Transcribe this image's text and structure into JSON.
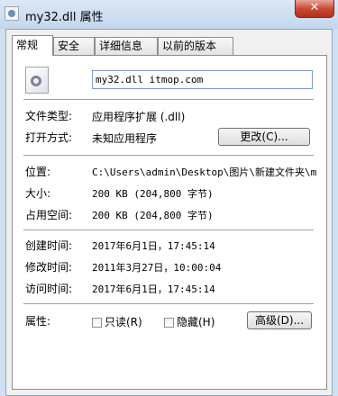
{
  "window": {
    "title": "my32.dll 属性",
    "close_glyph": "✕"
  },
  "tabs": [
    {
      "label": "常规",
      "active": true
    },
    {
      "label": "安全",
      "active": false
    },
    {
      "label": "详细信息",
      "active": false
    },
    {
      "label": "以前的版本",
      "active": false
    }
  ],
  "general": {
    "file_name": "my32.dll itmop.com",
    "file_type_label": "文件类型:",
    "file_type_value": "应用程序扩展 (.dll)",
    "open_with_label": "打开方式:",
    "open_with_value": "未知应用程序",
    "change_button": "更改(C)...",
    "location_label": "位置:",
    "location_value": "C:\\Users\\admin\\Desktop\\图片\\新建文件夹\\my",
    "size_label": "大小:",
    "size_value": "200 KB (204,800 字节)",
    "disk_size_label": "占用空间:",
    "disk_size_value": "200 KB (204,800 字节)",
    "created_label": "创建时间:",
    "created_value": "2017年6月1日，17:45:14",
    "modified_label": "修改时间:",
    "modified_value": "2011年3月27日，10:00:04",
    "accessed_label": "访问时间:",
    "accessed_value": "2017年6月1日，17:45:14",
    "attributes_label": "属性:",
    "readonly_label": "只读(R)",
    "readonly_checked": false,
    "hidden_label": "隐藏(H)",
    "hidden_checked": false,
    "advanced_button": "高级(D)..."
  }
}
